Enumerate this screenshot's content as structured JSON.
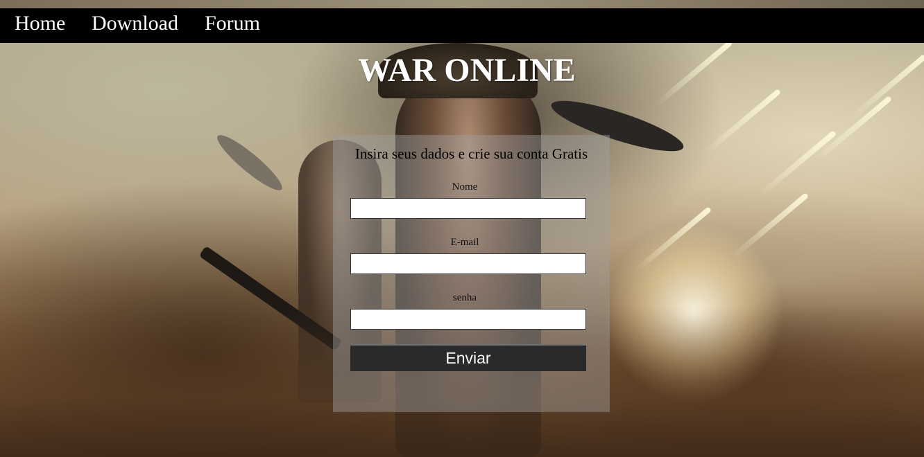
{
  "nav": {
    "items": [
      {
        "label": "Home"
      },
      {
        "label": "Download"
      },
      {
        "label": "Forum"
      }
    ]
  },
  "hero": {
    "title": "WAR ONLINE"
  },
  "form": {
    "heading": "Insira seus dados e crie sua conta Gratis",
    "fields": {
      "nome": {
        "label": "Nome",
        "value": ""
      },
      "email": {
        "label": "E-mail",
        "value": ""
      },
      "senha": {
        "label": "senha",
        "value": ""
      }
    },
    "submit_label": "Enviar"
  },
  "colors": {
    "navbar_bg": "#000000",
    "nav_text": "#ffffff",
    "title_text": "#ffffff",
    "button_bg": "#2a2a2a"
  }
}
